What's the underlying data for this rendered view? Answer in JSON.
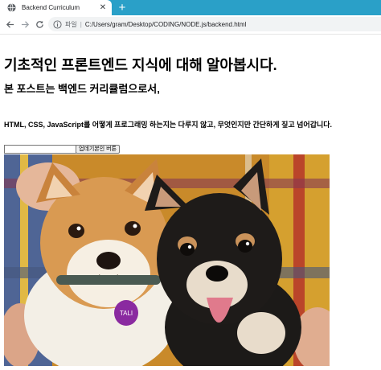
{
  "browser": {
    "tab_title": "Backend Curriculum",
    "close_glyph": "✕",
    "new_tab_glyph": "+",
    "security_chip": "파일",
    "address_separator": "|",
    "url": "C:/Users/gram/Desktop/CODING/NODE.js/backend.html",
    "tabstrip_color": "#2aa0c8"
  },
  "page": {
    "heading": "기초적인 프론트엔드 지식에 대해 알아봅시다.",
    "subheading": "본 포스트는 백엔드 커리큘럼으로서,",
    "paragraph": "HTML, CSS, JavaScript를 어떻게 프로그래밍 하는지는 다루지 않고, 무엇인지만 간단하게 짚고 넘어갑니다.",
    "input_value": "",
    "button_label": "업데기본인 버튼",
    "image_tag_text": "TALI"
  }
}
